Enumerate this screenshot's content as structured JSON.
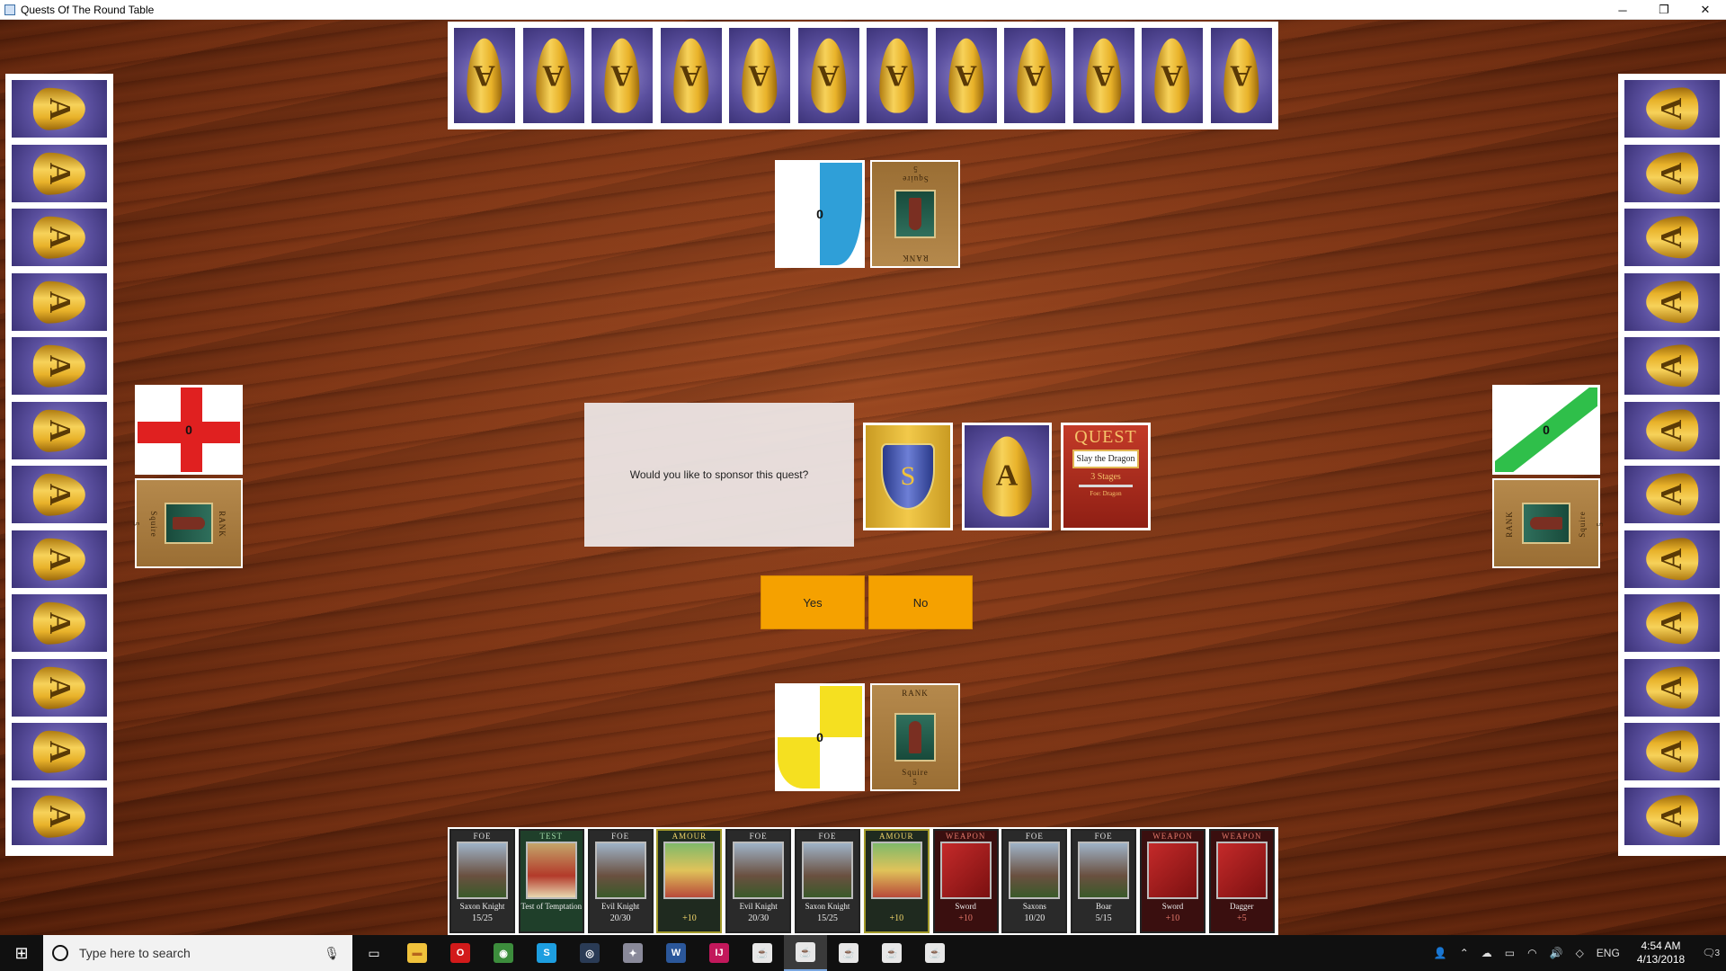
{
  "window": {
    "title": "Quests Of The Round Table",
    "minimize": "─",
    "maximize": "❐",
    "close": "✕"
  },
  "card_back_letter": "A",
  "top_hand_count": 12,
  "side_hand_count": 12,
  "players": {
    "top": {
      "shield_value": "0",
      "rank_label": "RANK",
      "rank_name": "Squire",
      "rank_points": "5",
      "shield_color": "#2f9fd8"
    },
    "left": {
      "shield_value": "0",
      "rank_label": "RANK",
      "rank_name": "Squire",
      "rank_points": "5",
      "shield_color": "#e02020"
    },
    "right": {
      "shield_value": "0",
      "rank_label": "RANK",
      "rank_name": "Squire",
      "rank_points": "5",
      "shield_color": "#2fbf4a"
    },
    "bottom": {
      "shield_value": "0",
      "rank_label": "RANK",
      "rank_name": "Squire",
      "rank_points": "5",
      "shield_color": "#f5e020"
    }
  },
  "decks": {
    "story_letter": "S",
    "adventure_letter": "A",
    "quest": {
      "title": "QUEST",
      "name": "Slay the Dragon",
      "stages": "3 Stages",
      "foe": "Foe: Dragon"
    }
  },
  "dialog": {
    "message": "Would you like to sponsor this quest?"
  },
  "buttons": {
    "yes": "Yes",
    "no": "No"
  },
  "hand": [
    {
      "type": "FOE",
      "name": "Saxon Knight",
      "value": "15/25",
      "kind": "foe"
    },
    {
      "type": "TEST",
      "name": "Test of Temptation",
      "value": "",
      "kind": "test"
    },
    {
      "type": "FOE",
      "name": "Evil Knight",
      "value": "20/30",
      "kind": "foe"
    },
    {
      "type": "AMOUR",
      "name": "",
      "value": "+10",
      "kind": "amour"
    },
    {
      "type": "FOE",
      "name": "Evil Knight",
      "value": "20/30",
      "kind": "foe"
    },
    {
      "type": "FOE",
      "name": "Saxon Knight",
      "value": "15/25",
      "kind": "foe"
    },
    {
      "type": "AMOUR",
      "name": "",
      "value": "+10",
      "kind": "amour"
    },
    {
      "type": "WEAPON",
      "name": "Sword",
      "value": "+10",
      "kind": "weapon"
    },
    {
      "type": "FOE",
      "name": "Saxons",
      "value": "10/20",
      "kind": "foe"
    },
    {
      "type": "FOE",
      "name": "Boar",
      "value": "5/15",
      "kind": "foe"
    },
    {
      "type": "WEAPON",
      "name": "Sword",
      "value": "+10",
      "kind": "weapon"
    },
    {
      "type": "WEAPON",
      "name": "Dagger",
      "value": "+5",
      "kind": "weapon"
    }
  ],
  "taskbar": {
    "search_placeholder": "Type here to search",
    "apps": [
      "file-explorer",
      "opera",
      "chrome",
      "skype",
      "steam",
      "game-app",
      "word",
      "intellij",
      "java-app-1",
      "java-app-2",
      "java-app-3",
      "java-app-4",
      "java-app-5"
    ],
    "language": "ENG",
    "time": "4:54 AM",
    "date": "4/13/2018",
    "notification_count": "3"
  }
}
